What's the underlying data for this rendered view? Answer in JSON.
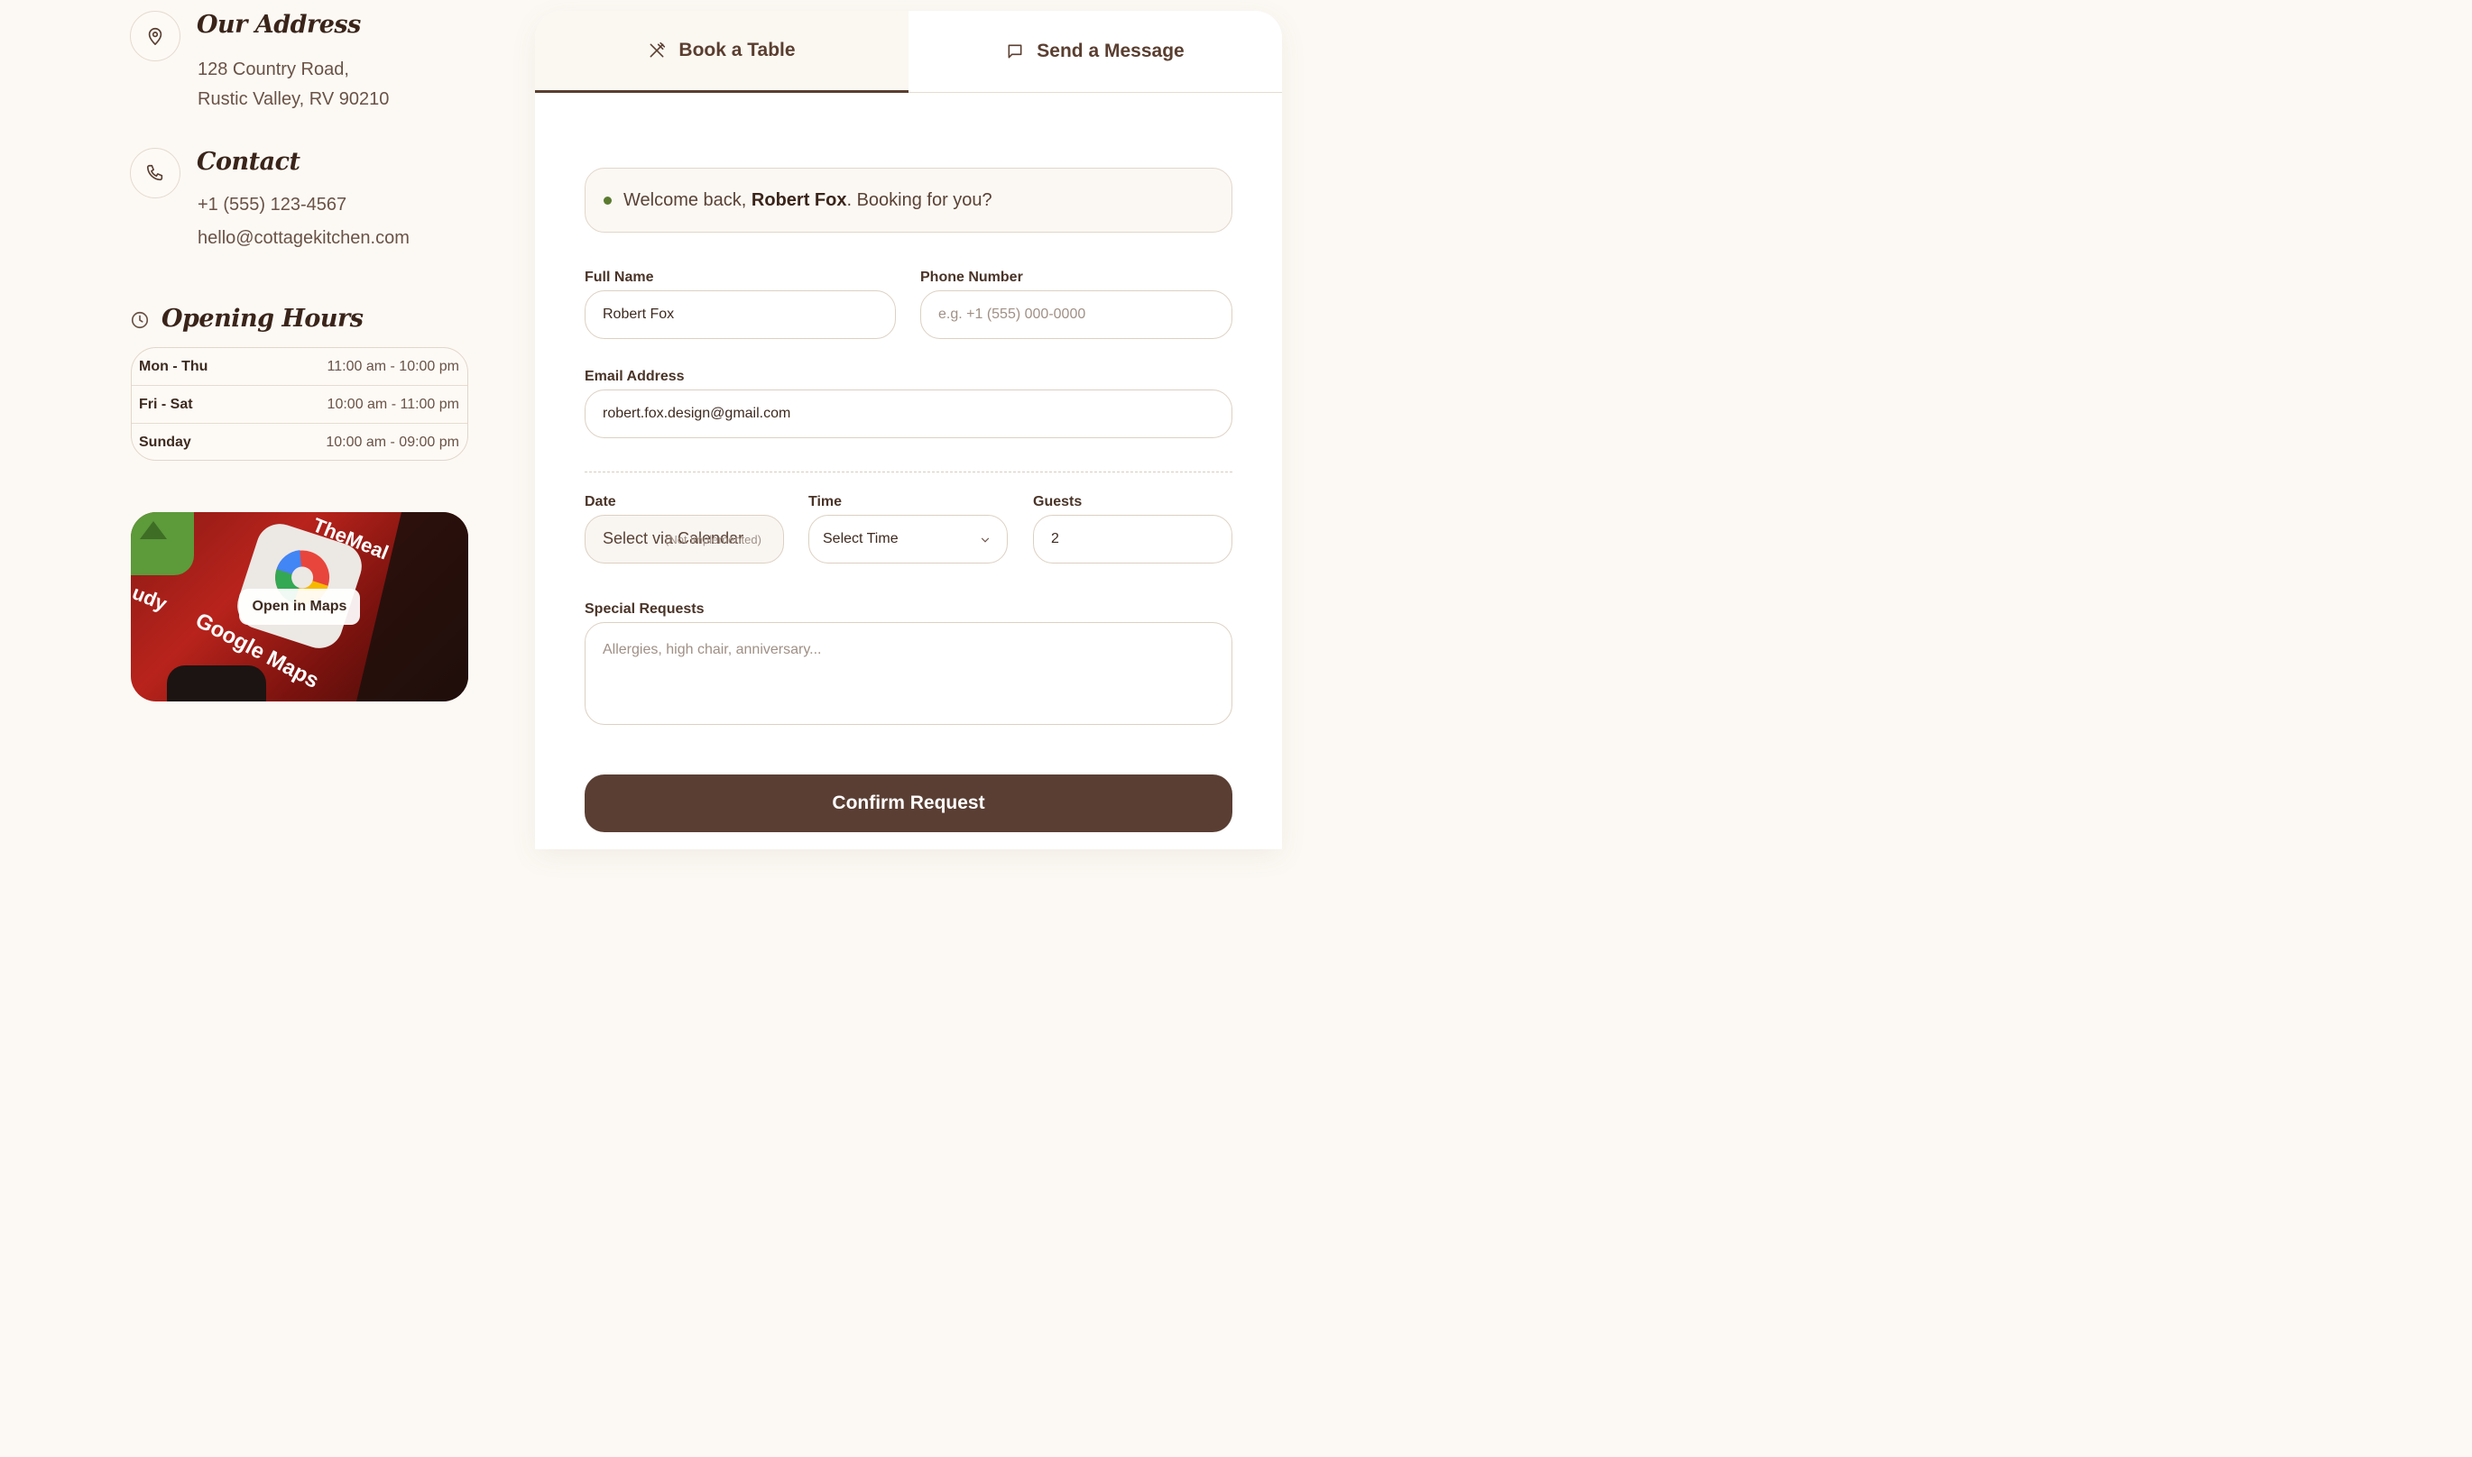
{
  "address": {
    "heading": "Our Address",
    "line1": "128 Country Road,",
    "line2": "Rustic Valley, RV 90210",
    "icon": "map-pin-icon"
  },
  "contact": {
    "heading": "Contact",
    "phone": "+1 (555) 123-4567",
    "email": "hello@cottagekitchen.com",
    "icon": "phone-icon"
  },
  "hours": {
    "heading": "Opening Hours",
    "icon": "clock-icon",
    "rows": [
      {
        "day": "Mon - Thu",
        "time": "11:00 am - 10:00 pm"
      },
      {
        "day": "Fri - Sat",
        "time": "10:00 am - 11:00 pm"
      },
      {
        "day": "Sunday",
        "time": "10:00 am - 09:00 pm"
      }
    ]
  },
  "map": {
    "button_label": "Open in Maps"
  },
  "tabs": [
    {
      "label": "Book a Table",
      "icon": "cutlery-icon",
      "active": true
    },
    {
      "label": "Send a Message",
      "icon": "message-icon",
      "active": false
    }
  ],
  "welcome": {
    "prefix": "Welcome back, ",
    "name": "Robert Fox",
    "suffix": ". Booking for you?",
    "status_color": "#5b7a2f"
  },
  "form": {
    "full_name_label": "Full Name",
    "full_name_value": "Robert Fox",
    "phone_label": "Phone Number",
    "phone_placeholder": "e.g. +1 (555) 000-0000",
    "email_label": "Email Address",
    "email_value": "robert.fox.design@gmail.com",
    "date_label": "Date",
    "date_value": "Select via Calendar",
    "date_hint": "(Not implemented)",
    "time_label": "Time",
    "time_value": "Select Time",
    "guests_label": "Guests",
    "guests_value": "2",
    "requests_label": "Special Requests",
    "requests_placeholder": "Allergies, high chair, anniversary...",
    "submit_label": "Confirm Request"
  },
  "colors": {
    "background": "#fcf9f4",
    "accent_brown": "#5a3e33",
    "text_dark": "#3a241a"
  }
}
